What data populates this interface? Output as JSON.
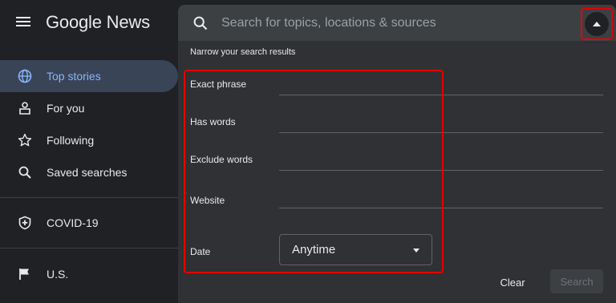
{
  "header": {
    "logo": "Google News"
  },
  "search": {
    "placeholder": "Search for topics, locations & sources"
  },
  "sidebar": {
    "items": [
      {
        "label": "Top stories",
        "icon": "globe-icon",
        "active": true
      },
      {
        "label": "For you",
        "icon": "person-icon"
      },
      {
        "label": "Following",
        "icon": "star-icon"
      },
      {
        "label": "Saved searches",
        "icon": "search-icon"
      },
      {
        "label": "COVID-19",
        "icon": "shield-plus-icon"
      },
      {
        "label": "U.S.",
        "icon": "flag-icon"
      }
    ]
  },
  "advanced": {
    "hint": "Narrow your search results",
    "exact_phrase_label": "Exact phrase",
    "has_words_label": "Has words",
    "exclude_words_label": "Exclude words",
    "website_label": "Website",
    "date_label": "Date",
    "date_value": "Anytime",
    "clear_label": "Clear",
    "search_label": "Search"
  },
  "colors": {
    "background": "#202124",
    "accent": "#8ab4f8",
    "highlight_border": "#e60000"
  }
}
